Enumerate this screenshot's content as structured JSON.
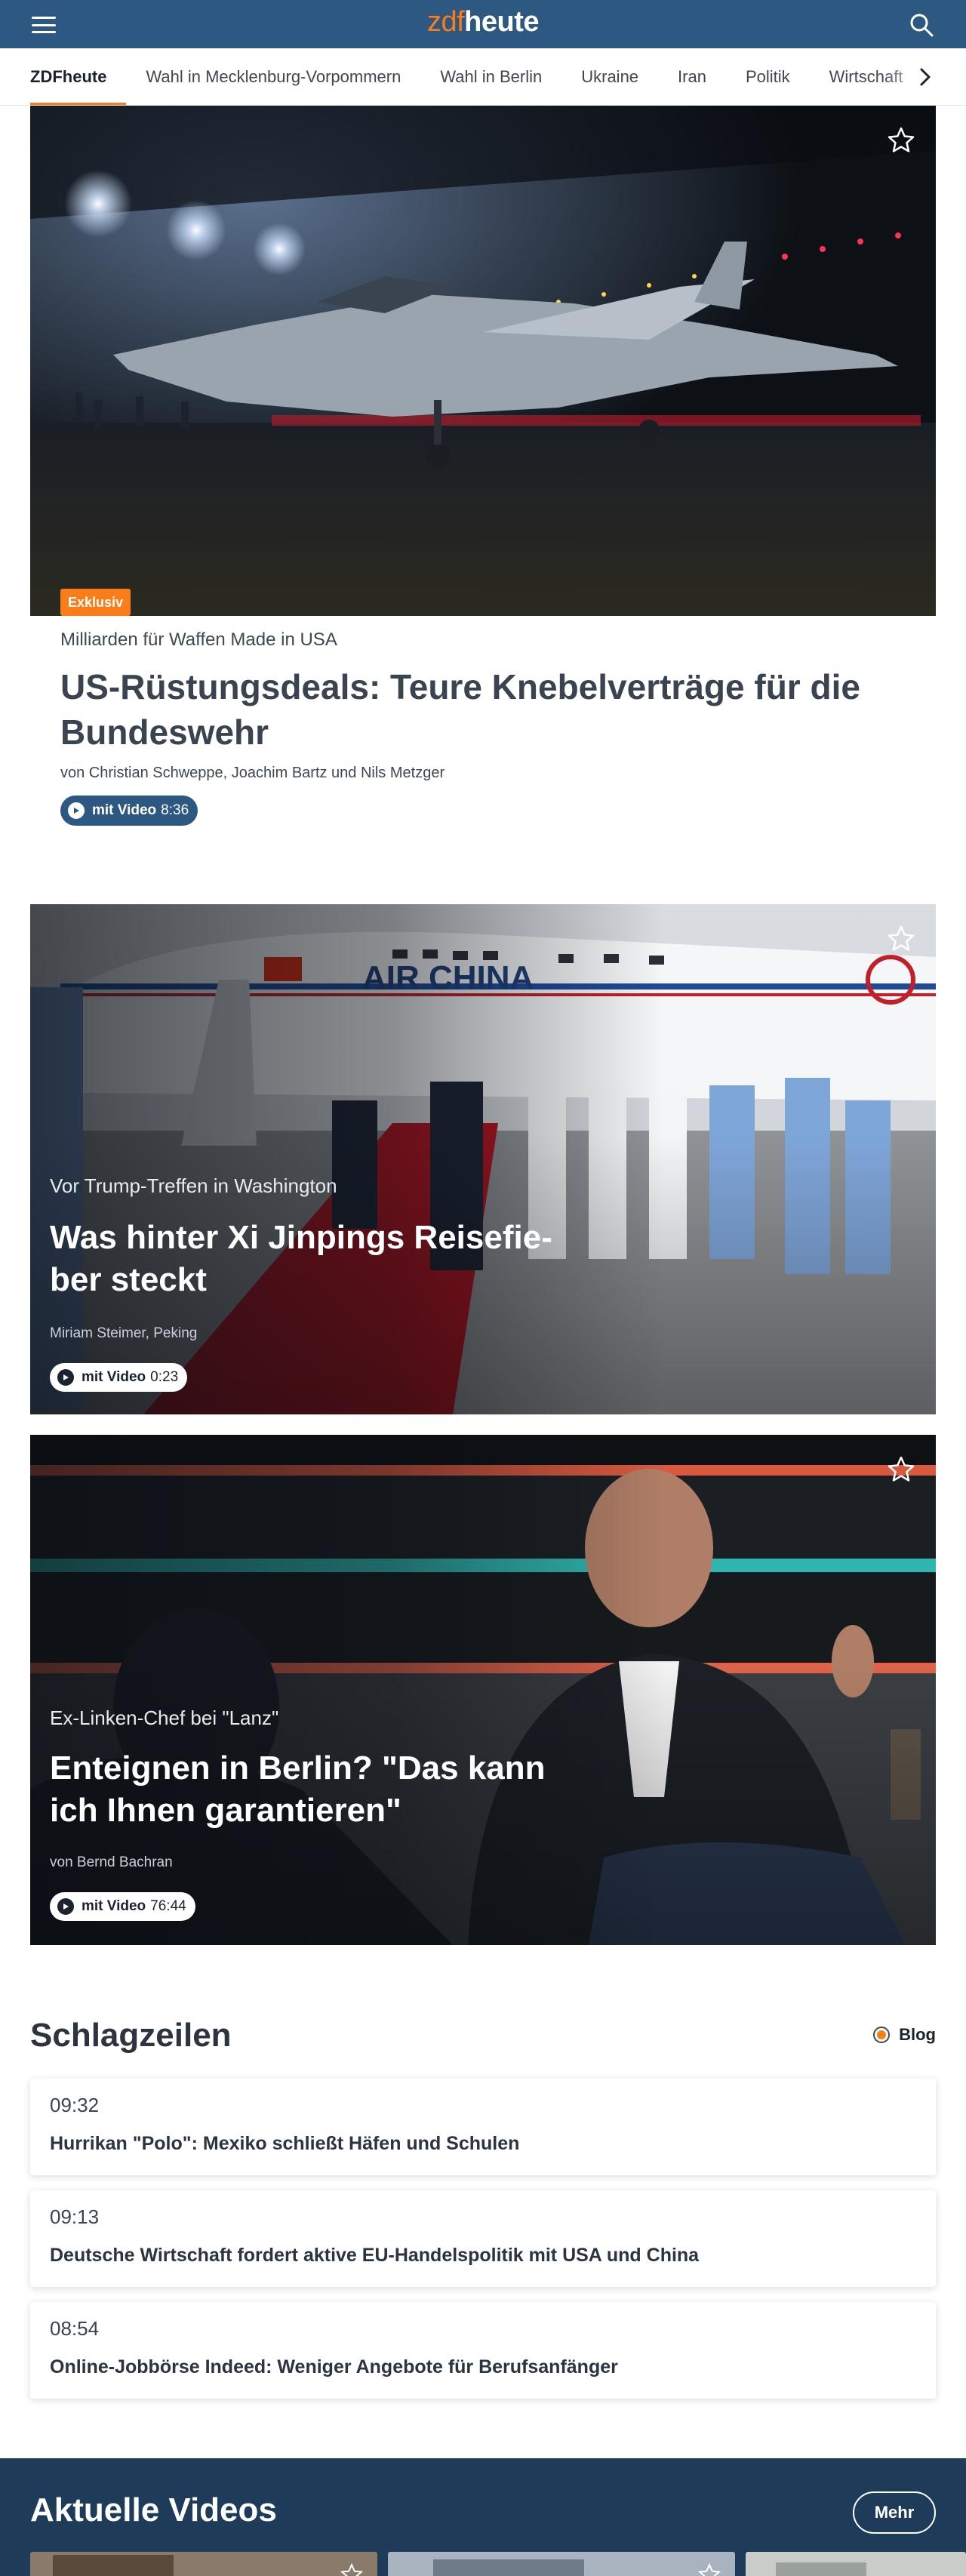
{
  "header": {
    "logo_part1": "zdf",
    "logo_part2": "heute"
  },
  "nav": {
    "items": [
      "ZDFheute",
      "Wahl in Mecklenburg-Vorpommern",
      "Wahl in Berlin",
      "Ukraine",
      "Iran",
      "Politik",
      "Wirtschaft"
    ]
  },
  "hero": {
    "badge": "Exklusiv",
    "kicker": "Milliarden für Waffen Made in USA",
    "title": "US-Rüstungsdeals: Teure Knebelverträge für die Bundeswehr",
    "author": "von Christian Schweppe, Joachim Bartz und Nils Metzger",
    "video_label": "mit Video",
    "video_duration": "8:36"
  },
  "teasers": [
    {
      "kicker": "Vor Trump-Treffen in Washington",
      "title": "Was hinter Xi Jinpings Reisefie­ber steckt",
      "author": "Miriam Steimer, Peking",
      "video_label": "mit Video",
      "video_duration": "0:23"
    },
    {
      "kicker": "Ex-Linken-Chef bei \"Lanz\"",
      "title": "Enteignen in Berlin? \"Das kann ich Ihnen garantieren\"",
      "author": "von Bernd Bachran",
      "video_label": "mit Video",
      "video_duration": "76:44"
    }
  ],
  "headlines": {
    "title": "Schlagzeilen",
    "blog_label": "Blog",
    "items": [
      {
        "time": "09:32",
        "text": "Hurrikan \"Polo\": Mexiko schließt Häfen und Schulen"
      },
      {
        "time": "09:13",
        "text": "Deutsche Wirtschaft fordert aktive EU-Handelspolitik mit USA und China"
      },
      {
        "time": "08:54",
        "text": "Online-Jobbörse Indeed: Weniger Angebote für Berufsanfänger"
      }
    ]
  },
  "videos": {
    "title": "Aktuelle Videos",
    "more_label": "Mehr"
  },
  "colors": {
    "brand_blue": "#2c5882",
    "accent_orange": "#fa7d19",
    "videos_bg": "#1f3b5a"
  },
  "icons": [
    "menu-icon",
    "search-icon",
    "chevron-right-icon",
    "star-icon",
    "play-icon",
    "live-dot-icon"
  ]
}
